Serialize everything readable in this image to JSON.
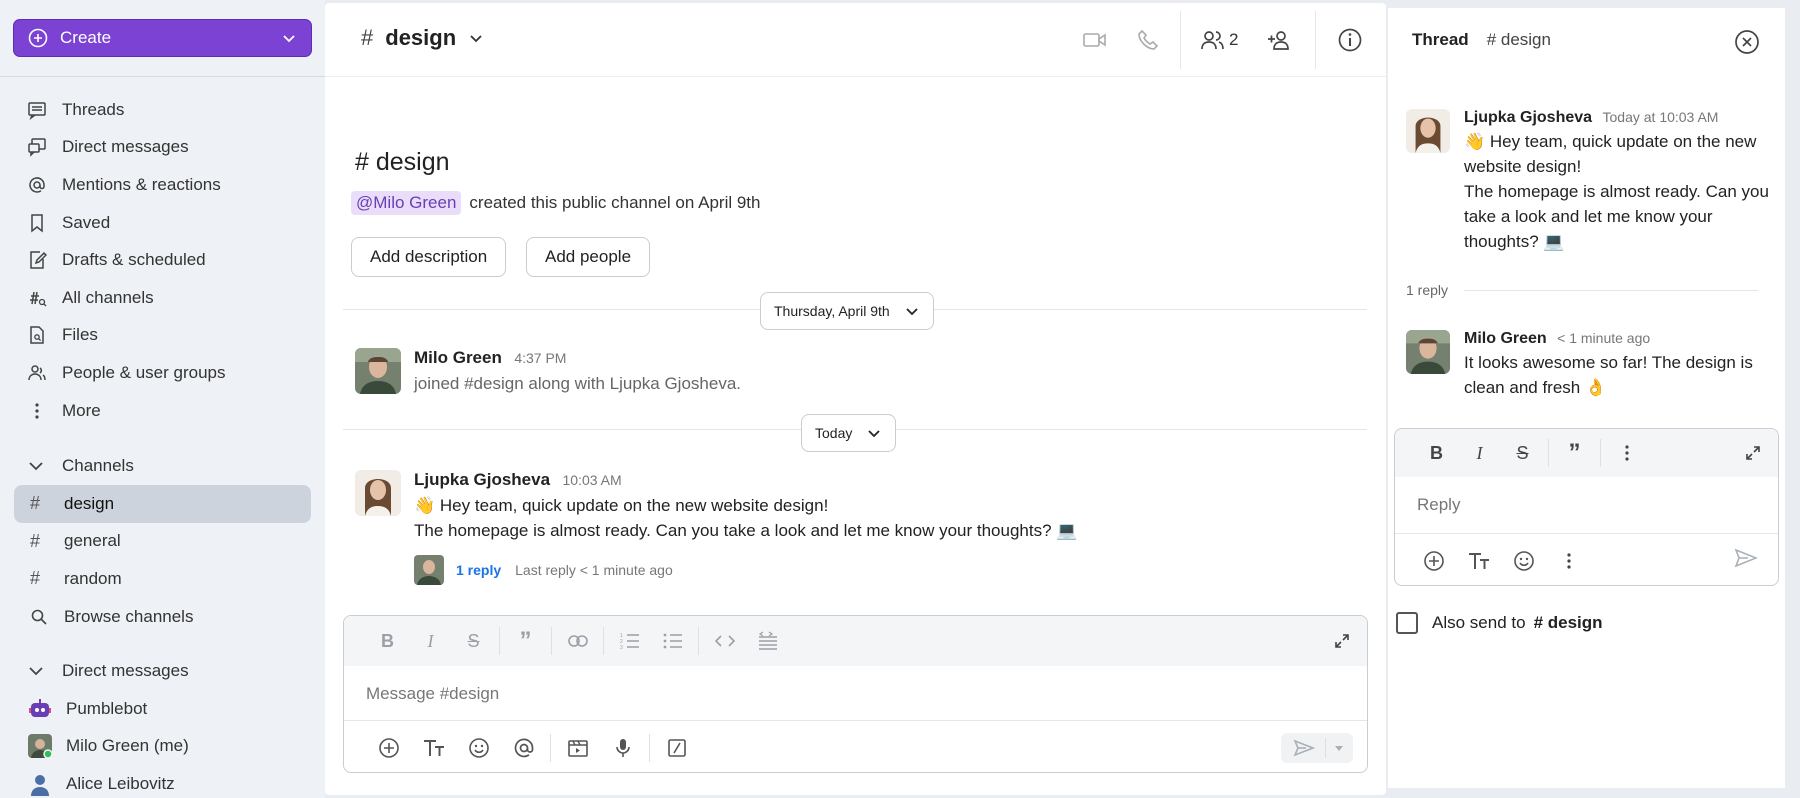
{
  "sidebar": {
    "create_label": "Create",
    "nav": [
      {
        "label": "Threads",
        "icon": "threads-icon"
      },
      {
        "label": "Direct messages",
        "icon": "direct-messages-icon"
      },
      {
        "label": "Mentions & reactions",
        "icon": "at-icon"
      },
      {
        "label": "Saved",
        "icon": "bookmark-icon"
      },
      {
        "label": "Drafts & scheduled",
        "icon": "draft-icon"
      },
      {
        "label": "All channels",
        "icon": "channels-icon"
      },
      {
        "label": "Files",
        "icon": "file-icon"
      },
      {
        "label": "People & user groups",
        "icon": "people-icon"
      },
      {
        "label": "More",
        "icon": "more-vertical-icon"
      }
    ],
    "channels_header": "Channels",
    "channels": [
      "design",
      "general",
      "random"
    ],
    "active_channel": "design",
    "browse_label": "Browse channels",
    "dm_header": "Direct messages",
    "dms": [
      "Pumblebot",
      "Milo Green (me)",
      "Alice Leibovitz"
    ]
  },
  "header": {
    "hash": "#",
    "channel": "design",
    "member_count": "2"
  },
  "intro": {
    "title": "# design",
    "mention": "@Milo Green",
    "created_text": "created this public channel on April 9th",
    "add_description": "Add description",
    "add_people": "Add people"
  },
  "dates": {
    "first": "Thursday, April 9th",
    "second": "Today"
  },
  "messages": [
    {
      "name": "Milo Green",
      "time": "4:37 PM",
      "text": "joined #design along with Ljupka Gjosheva."
    },
    {
      "name": "Ljupka Gjosheva",
      "time": "10:03 AM",
      "line1": "👋 Hey team, quick update on the new website design!",
      "line2": "The homepage is almost ready. Can you take a look and let me know your thoughts? 💻",
      "reply_link": "1 reply",
      "last_reply": "Last reply < 1 minute ago"
    }
  ],
  "composer": {
    "placeholder": "Message #design"
  },
  "thread": {
    "title": "Thread",
    "channel": "# design",
    "root": {
      "name": "Ljupka Gjosheva",
      "time": "Today at 10:03 AM",
      "text1": "👋 Hey team, quick update on the new website design!",
      "text2": "The homepage is almost ready. Can you take a look and let me know your thoughts? 💻"
    },
    "reply_count": "1 reply",
    "reply": {
      "name": "Milo Green",
      "time": "< 1 minute ago",
      "text": "It looks awesome so far! The design is clean and fresh 👌"
    },
    "reply_placeholder": "Reply",
    "also_send": "Also send to",
    "also_channel": "# design"
  },
  "colors": {
    "accent": "#7c42d3",
    "link": "#1a73e8",
    "mention_bg": "#e9ddfa"
  }
}
